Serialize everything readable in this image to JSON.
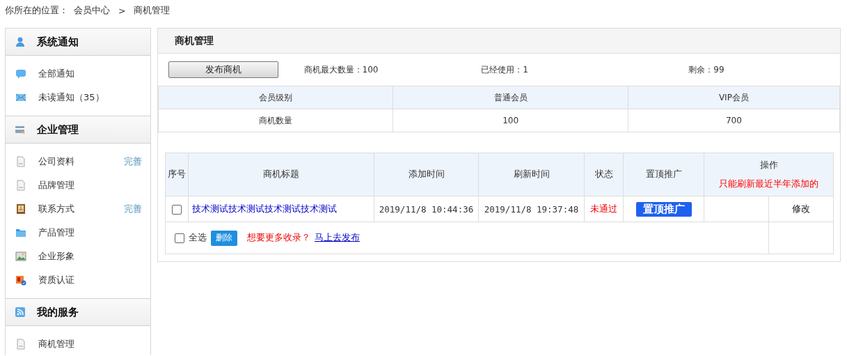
{
  "breadcrumb": {
    "label": "你所在的位置：",
    "items": [
      "会员中心",
      "商机管理"
    ],
    "separator": ">"
  },
  "sidebar": [
    {
      "title": "系统通知",
      "kind": "user",
      "items": [
        {
          "label": "全部通知",
          "kind": "chat"
        },
        {
          "label": "未读通知（35）",
          "kind": "mail"
        }
      ]
    },
    {
      "title": "企业管理",
      "kind": "card",
      "items": [
        {
          "label": "公司资料",
          "kind": "doc",
          "action": "完善"
        },
        {
          "label": "品牌管理",
          "kind": "doc"
        },
        {
          "label": "联系方式",
          "kind": "contact",
          "action": "完善"
        },
        {
          "label": "产品管理",
          "kind": "folder"
        },
        {
          "label": "企业形象",
          "kind": "image"
        },
        {
          "label": "资质认证",
          "kind": "cert"
        }
      ]
    },
    {
      "title": "我的服务",
      "kind": "rss",
      "items": [
        {
          "label": "商机管理",
          "kind": "doc"
        }
      ]
    }
  ],
  "panel": {
    "title": "商机管理",
    "publish_button": "发布商机",
    "stats": [
      "商机最大数量：100",
      "已经使用：1",
      "剩余：99"
    ],
    "quota_table": {
      "columns": [
        "会员级别",
        "普通会员",
        "VIP会员"
      ],
      "rows": [
        [
          "商机数量",
          "100",
          "700"
        ]
      ]
    },
    "list": {
      "columns": [
        "序号",
        "商机标题",
        "添加时间",
        "刷新时间",
        "状态",
        "置顶推广",
        "操作"
      ],
      "note": "只能刷新最近半年添加的",
      "rows": [
        {
          "checked": false,
          "title": "技术测试技术测试技术测试技术测试",
          "added": "2019/11/8 10:44:36",
          "refreshed": "2019/11/8 19:37:48",
          "status": "未通过",
          "promote": "置顶推广",
          "edit": "修改"
        }
      ],
      "footer": {
        "select_all": "全选",
        "select_all_checked": false,
        "delete": "删除",
        "prompt": "想要更多收录？",
        "link": "马上去发布"
      }
    }
  }
}
